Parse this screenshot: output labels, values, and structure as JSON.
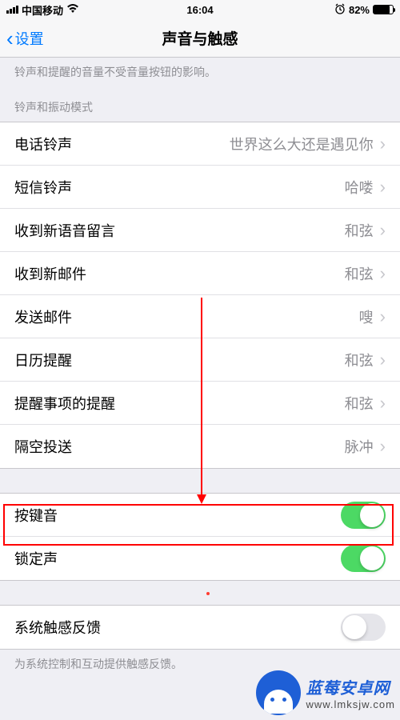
{
  "status": {
    "carrier": "中国移动",
    "time": "16:04",
    "battery_pct": "82%"
  },
  "nav": {
    "back": "设置",
    "title": "声音与触感"
  },
  "volume_footer": "铃声和提醒的音量不受音量按钮的影响。",
  "ringtone_section": {
    "header": "铃声和振动模式",
    "rows": [
      {
        "label": "电话铃声",
        "value": "世界这么大还是遇见你"
      },
      {
        "label": "短信铃声",
        "value": "哈喽"
      },
      {
        "label": "收到新语音留言",
        "value": "和弦"
      },
      {
        "label": "收到新邮件",
        "value": "和弦"
      },
      {
        "label": "发送邮件",
        "value": "嗖"
      },
      {
        "label": "日历提醒",
        "value": "和弦"
      },
      {
        "label": "提醒事项的提醒",
        "value": "和弦"
      },
      {
        "label": "隔空投送",
        "value": "脉冲"
      }
    ]
  },
  "keyboard_section": {
    "rows": [
      {
        "label": "按键音",
        "on": true
      },
      {
        "label": "锁定声",
        "on": true
      }
    ]
  },
  "haptics_section": {
    "rows": [
      {
        "label": "系统触感反馈",
        "on": false
      }
    ],
    "footer": "为系统控制和互动提供触感反馈。"
  },
  "watermark": {
    "title": "蓝莓安卓网",
    "url": "www.lmksjw.com"
  }
}
